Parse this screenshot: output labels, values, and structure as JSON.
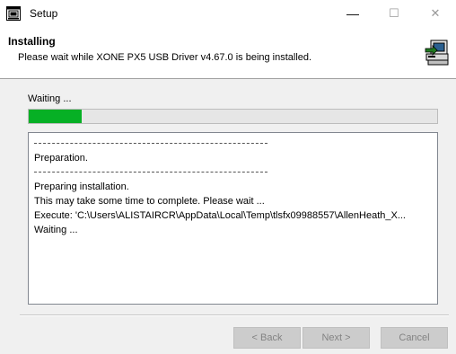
{
  "window": {
    "title": "Setup",
    "controls": {
      "minimize": "—",
      "maximize": "☐",
      "close": "✕"
    }
  },
  "header": {
    "title": "Installing",
    "subtitle": "Please wait while XONE PX5 USB Driver v4.67.0 is being installed."
  },
  "progress": {
    "status": "Waiting ...",
    "fraction": 0.13,
    "color": "#06b025"
  },
  "log": {
    "preparation": "Preparation.",
    "preparing": "Preparing installation.",
    "time_notice": "This may take some time to complete. Please wait ...",
    "execute": "Execute: 'C:\\Users\\ALISTAIRCR\\AppData\\Local\\Temp\\tlsfx09988557\\AllenHeath_X...",
    "waiting": "Waiting ..."
  },
  "buttons": {
    "back": "< Back",
    "next": "Next >",
    "cancel": "Cancel"
  },
  "icons": {
    "app": "setup-window-icon",
    "header": "installer-computer-icon"
  }
}
